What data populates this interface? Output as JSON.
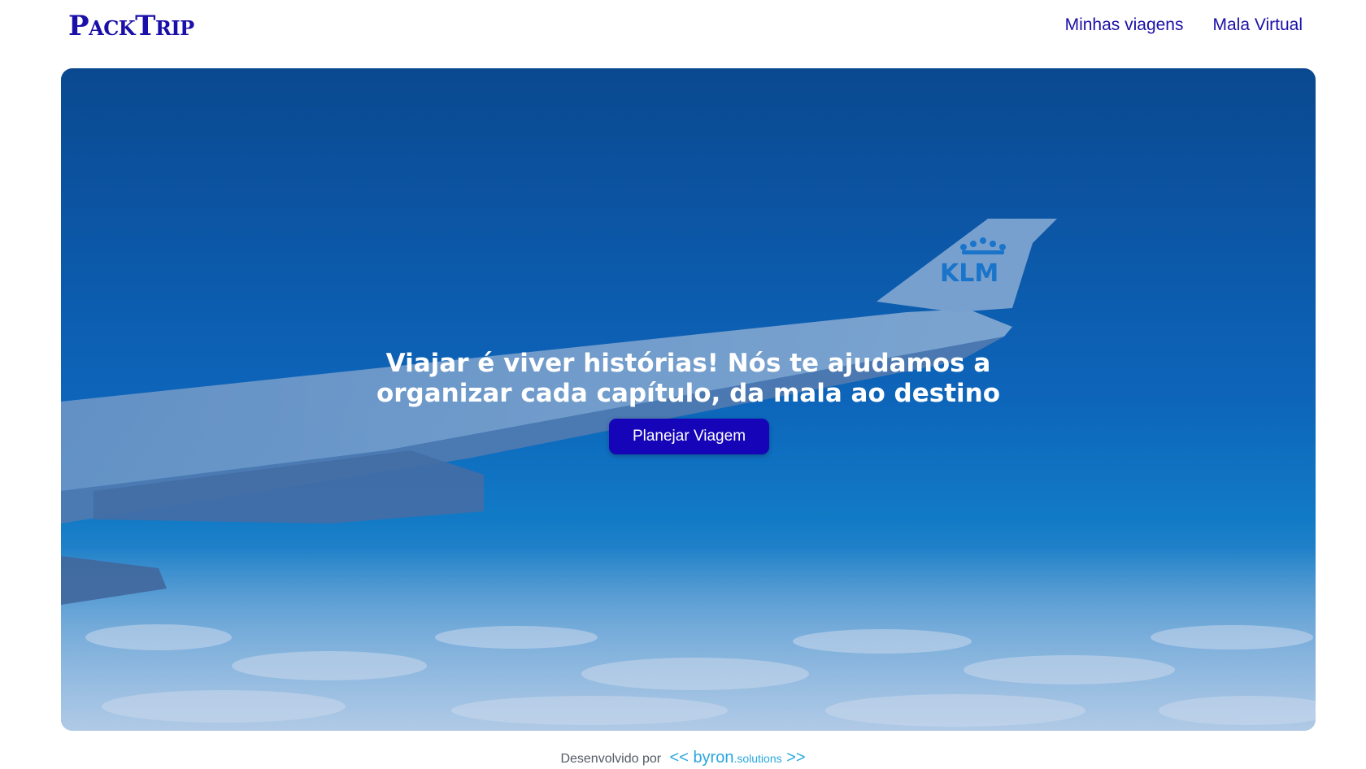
{
  "header": {
    "logo": "PackTrip",
    "nav": [
      {
        "label": "Minhas viagens"
      },
      {
        "label": "Mala Virtual"
      }
    ]
  },
  "hero": {
    "headline_line1": "Viajar é viver histórias! Nós te ajudamos a",
    "headline_line2": "organizar cada capítulo, da mala ao destino",
    "cta_label": "Planejar Viagem",
    "wing_logo": "KLM"
  },
  "footer": {
    "prefix": "Desenvolvido por",
    "brand_left": "<<",
    "brand_name": "byron",
    "brand_suffix": ".solutions",
    "brand_right": ">>"
  },
  "colors": {
    "brand": "#1a0fa8",
    "cta": "#1604b8",
    "byron": "#2aa7e0"
  }
}
